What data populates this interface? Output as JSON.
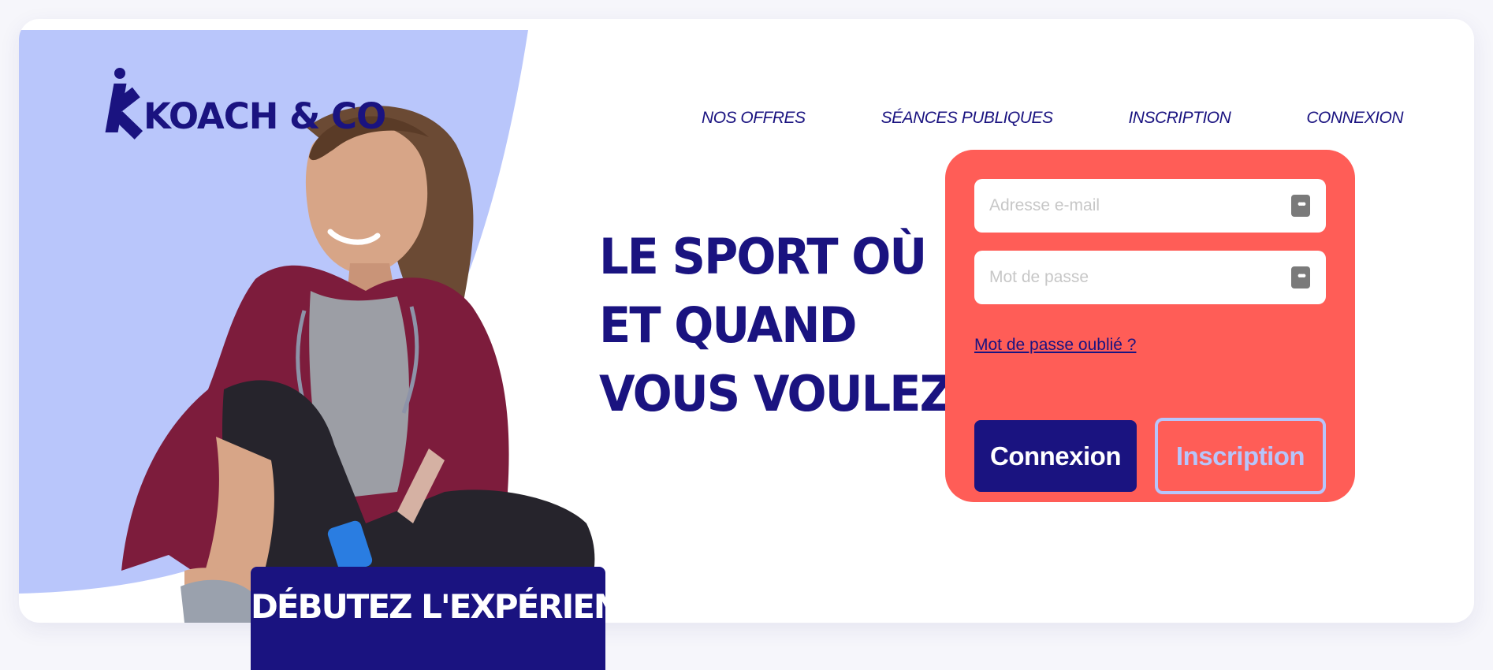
{
  "brand": {
    "name": "KOACH & CO"
  },
  "nav": {
    "items": [
      "NOS OFFRES",
      "SÉANCES PUBLIQUES",
      "INSCRIPTION",
      "CONNEXION"
    ]
  },
  "hero": {
    "headline_lines": [
      "LE SPORT OÙ",
      "ET QUAND",
      "VOUS VOULEZ"
    ],
    "cta_label": "DÉBUTEZ L'EXPÉRIENCE",
    "image_alt": "femme souriante en tenue de sport laçant sa chaussure"
  },
  "login": {
    "email_placeholder": "Adresse e-mail",
    "email_value": "",
    "password_placeholder": "Mot de passe",
    "password_value": "",
    "forgot_label": "Mot de passe oublié ?",
    "connexion_label": "Connexion",
    "inscription_label": "Inscription",
    "field_icon": "dots-icon"
  },
  "colors": {
    "brand_navy": "#1a1380",
    "coral": "#ff5d57",
    "lavender": "#b9c6fb",
    "page_bg": "#f6f6fb"
  }
}
